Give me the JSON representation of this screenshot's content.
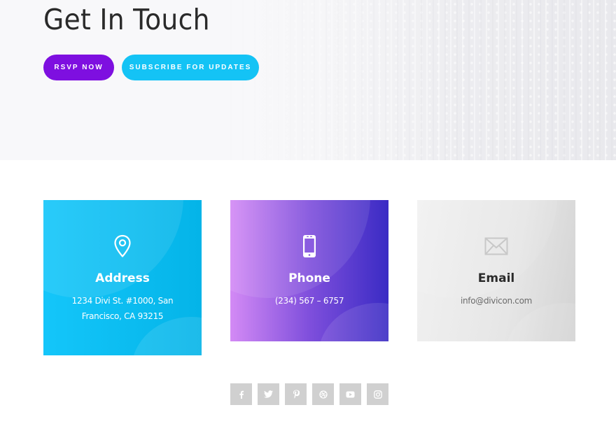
{
  "hero": {
    "title": "Get In Touch",
    "buttons": {
      "rsvp_label": "RSVP NOW",
      "subscribe_label": "SUBSCRIBE FOR UPDATES"
    }
  },
  "contact_cards": [
    {
      "icon": "map-pin-icon",
      "title": "Address",
      "text": "1234 Divi St. #1000, San Francisco, CA 93215"
    },
    {
      "icon": "smartphone-icon",
      "title": "Phone",
      "text": "(234) 567 – 6757"
    },
    {
      "icon": "envelope-icon",
      "title": "Email",
      "text": "info@divicon.com"
    }
  ],
  "social_links": [
    {
      "icon": "facebook-icon",
      "label": "Facebook"
    },
    {
      "icon": "twitter-icon",
      "label": "Twitter"
    },
    {
      "icon": "pinterest-icon",
      "label": "Pinterest"
    },
    {
      "icon": "dribbble-icon",
      "label": "Dribbble"
    },
    {
      "icon": "youtube-icon",
      "label": "YouTube"
    },
    {
      "icon": "instagram-icon",
      "label": "Instagram"
    }
  ],
  "colors": {
    "rsvp": "#7e0fe0",
    "subscribe": "#14c3f5",
    "address_card": "#0ab9ee",
    "phone_card_start": "#d38af5",
    "phone_card_end": "#3a2bc4",
    "email_card": "#e2e2e2",
    "social_bg": "#d0d0d0"
  }
}
